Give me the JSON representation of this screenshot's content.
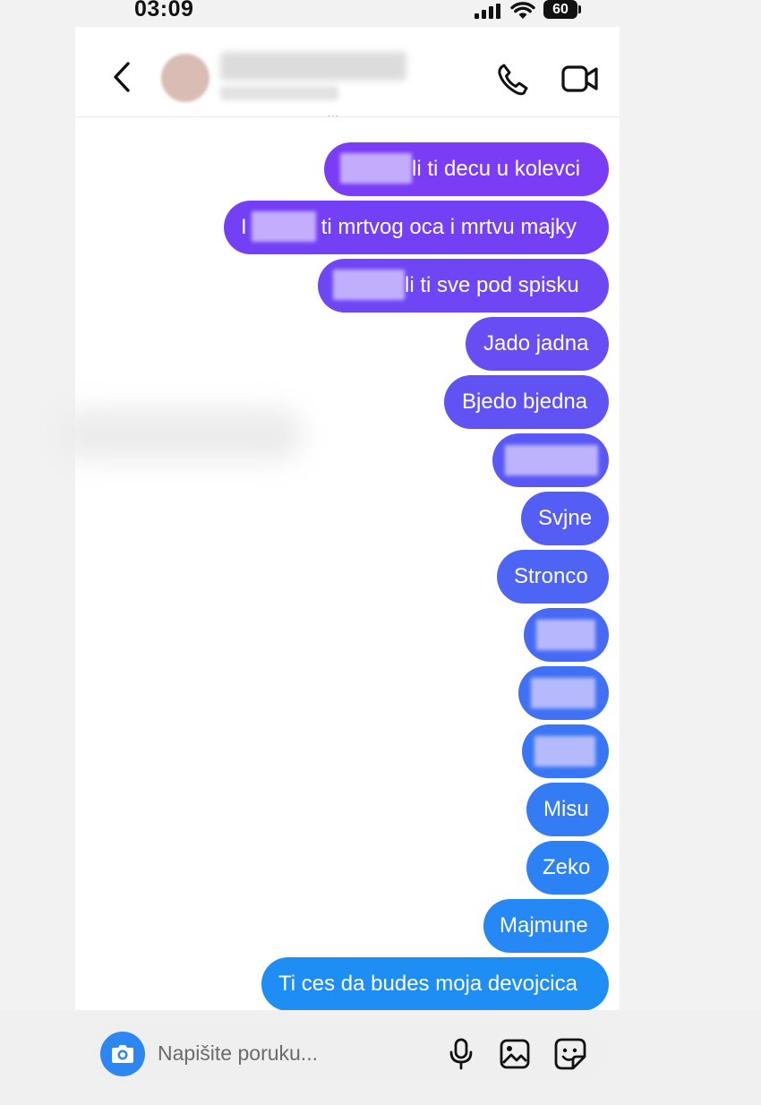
{
  "status": {
    "time": "03:09",
    "battery": "60"
  },
  "header": {
    "back_icon": "chevron-left-icon",
    "call_icon": "phone-icon",
    "video_icon": "video-camera-icon"
  },
  "messages": [
    {
      "text": "li ti decu u kolevci",
      "prefix": "",
      "redacted": true,
      "color": "#7a3cf5"
    },
    {
      "text": "ti mrtvog oca i mrtvu majky",
      "prefix": "I",
      "redacted": true,
      "color": "#7440f5"
    },
    {
      "text": "li ti sve pod spisku",
      "prefix": "",
      "redacted": true,
      "color": "#6e46f4"
    },
    {
      "text": "Jado jadna",
      "prefix": "",
      "redacted": false,
      "color": "#684cf4"
    },
    {
      "text": "Bjedo bjedna",
      "prefix": "",
      "redacted": false,
      "color": "#6152f4"
    },
    {
      "text": "",
      "prefix": "",
      "redacted": true,
      "color": "#5a58f4"
    },
    {
      "text": "Svjne",
      "prefix": "",
      "redacted": false,
      "color": "#545ef4"
    },
    {
      "text": "Stronco",
      "prefix": "",
      "redacted": false,
      "color": "#4d64f4"
    },
    {
      "text": "",
      "prefix": "",
      "redacted": true,
      "color": "#466af4"
    },
    {
      "text": "",
      "prefix": "",
      "redacted": true,
      "color": "#4070f4"
    },
    {
      "text": "",
      "prefix": "",
      "redacted": true,
      "color": "#3976f4"
    },
    {
      "text": "Misu",
      "prefix": "",
      "redacted": false,
      "color": "#337cf4"
    },
    {
      "text": "Zeko",
      "prefix": "",
      "redacted": false,
      "color": "#2c82f4"
    },
    {
      "text": "Majmune",
      "prefix": "",
      "redacted": false,
      "color": "#2688f4"
    },
    {
      "text": "Ti ces da budes moja devojcica",
      "prefix": "",
      "redacted": false,
      "color": "#1f8ef4"
    }
  ],
  "composer": {
    "placeholder": "Napišite poruku...",
    "camera_icon": "camera-icon",
    "mic_icon": "microphone-icon",
    "gallery_icon": "image-icon",
    "sticker_icon": "sticker-icon"
  }
}
